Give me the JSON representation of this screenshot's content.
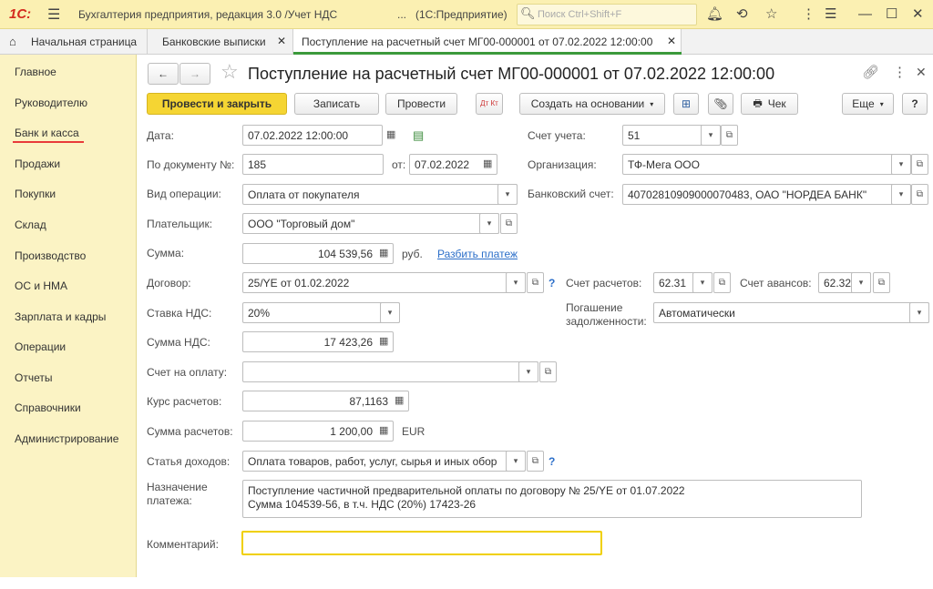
{
  "titlebar": {
    "logo": "1С:",
    "app_title": "Бухгалтерия предприятия, редакция 3.0 /Учет НДС",
    "ellipsis": "...",
    "platform": "(1С:Предприятие)",
    "search_placeholder": "Поиск Ctrl+Shift+F"
  },
  "tabs": {
    "home": "Начальная страница",
    "tab1": "Банковские выписки",
    "tab2": "Поступление на расчетный счет МГ00-000001 от 07.02.2022 12:00:00"
  },
  "sidebar": {
    "items": [
      "Главное",
      "Руководителю",
      "Банк и касса",
      "Продажи",
      "Покупки",
      "Склад",
      "Производство",
      "ОС и НМА",
      "Зарплата и кадры",
      "Операции",
      "Отчеты",
      "Справочники",
      "Администрирование"
    ],
    "active_color": "#e83a3a"
  },
  "form": {
    "title": "Поступление на расчетный счет МГ00-000001 от 07.02.2022 12:00:00",
    "toolbar": {
      "post_close": "Провести и закрыть",
      "save": "Записать",
      "post": "Провести",
      "dtkt": "Дт Кт",
      "create_based": "Создать на основании",
      "check": "Чек",
      "more": "Еще",
      "help": "?"
    },
    "labels": {
      "date": "Дата:",
      "doc_no": "По документу №:",
      "from": "от:",
      "op_type": "Вид операции:",
      "payer": "Плательщик:",
      "sum": "Сумма:",
      "currency": "руб.",
      "split": "Разбить платеж",
      "contract": "Договор:",
      "vat_rate": "Ставка НДС:",
      "vat_sum": "Сумма НДС:",
      "invoice": "Счет на оплату:",
      "rate": "Курс расчетов:",
      "settle_sum": "Сумма расчетов:",
      "settle_cur": "EUR",
      "income_item": "Статья доходов:",
      "purpose": "Назначение платежа:",
      "comment": "Комментарий:",
      "account": "Счет учета:",
      "org": "Организация:",
      "bank_acc": "Банковский счет:",
      "settle_acc": "Счет расчетов:",
      "adv_acc": "Счет авансов:",
      "repay": "Погашение задолженности:"
    },
    "values": {
      "date": "07.02.2022 12:00:00",
      "doc_no": "185",
      "from": "07.02.2022",
      "op_type": "Оплата от покупателя",
      "payer": "ООО \"Торговый дом\"",
      "sum": "104 539,56",
      "contract": "25/YE от 01.02.2022",
      "vat_rate": "20%",
      "vat_sum": "17 423,26",
      "invoice": "",
      "rate": "87,1163",
      "settle_sum": "1 200,00",
      "income_item": "Оплата товаров, работ, услуг, сырья и иных обор",
      "purpose_line1": "Поступление частичной предварительной оплаты по договору № 25/YE от 01.07.2022",
      "purpose_line2": "Сумма 104539-56, в т.ч. НДС (20%) 17423-26",
      "comment": "",
      "account": "51",
      "org": "ТФ-Мега ООО",
      "bank_acc": "40702810909000070483, ОАО \"НОРДЕА БАНК\"",
      "settle_acc": "62.31",
      "adv_acc": "62.32",
      "repay": "Автоматически"
    }
  },
  "colors": {
    "accent_yellow": "#f5d533",
    "titlebar": "#fbf0b2",
    "sidebar": "#fbf3c4",
    "link": "#2c6fc9"
  }
}
